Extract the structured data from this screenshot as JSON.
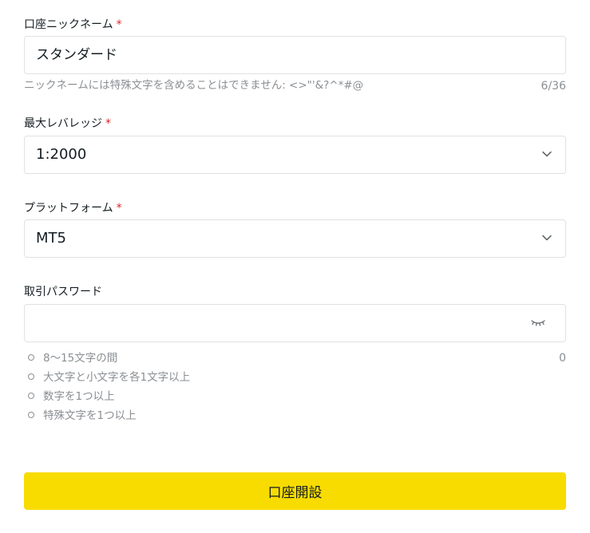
{
  "nickname": {
    "label": "口座ニックネーム",
    "required_mark": "*",
    "value": "スタンダード",
    "hint": "ニックネームには特殊文字を含めることはできません: <>\"'&?^*#@",
    "counter": "6/36"
  },
  "leverage": {
    "label": "最大レバレッジ",
    "required_mark": "*",
    "value": "1:2000"
  },
  "platform": {
    "label": "プラットフォーム",
    "required_mark": "*",
    "value": "MT5"
  },
  "password": {
    "label": "取引パスワード",
    "value": "",
    "counter": "0",
    "requirements": [
      "8～15文字の間",
      "大文字と小文字を各1文字以上",
      "数字を1つ以上",
      "特殊文字を1つ以上"
    ]
  },
  "submit_label": "口座開設",
  "colors": {
    "accent": "#f8dc00",
    "required": "#e02020",
    "muted_text": "#8b8f93",
    "border": "#dfe1e3"
  },
  "icons": {
    "select_arrow": "chevron-down-icon",
    "password_toggle": "eye-closed-icon",
    "requirement_bullet": "circle-bullet-icon"
  }
}
